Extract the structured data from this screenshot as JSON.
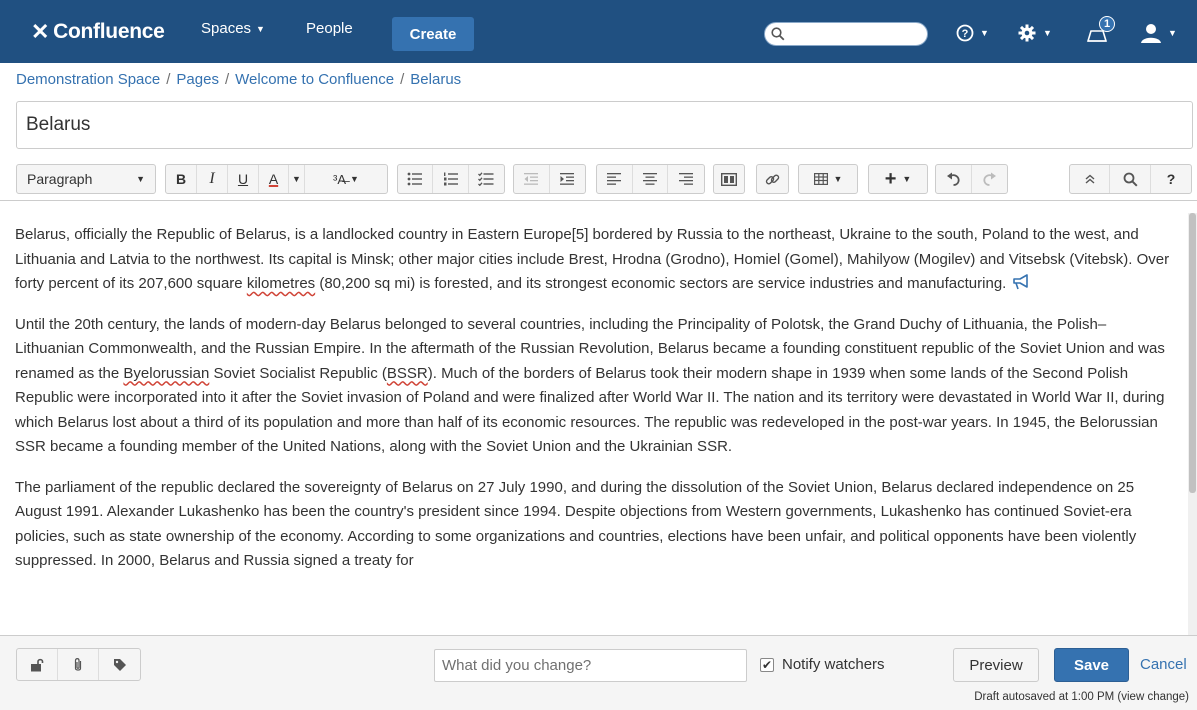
{
  "header": {
    "logo_text": "Confluence",
    "nav": {
      "spaces": "Spaces",
      "people": "People",
      "create": "Create"
    },
    "search_placeholder": "",
    "notification_count": "1",
    "brand_color": "#205081",
    "accent_color": "#3572b0"
  },
  "breadcrumb": [
    "Demonstration Space",
    "Pages",
    "Welcome to Confluence",
    "Belarus"
  ],
  "page_title": "Belarus",
  "toolbar": {
    "paragraph_style": "Paragraph",
    "bold": "B",
    "italic": "I",
    "underline": "U",
    "text_color": "A"
  },
  "content": {
    "p1": [
      "Belarus, officially the Republic of Belarus, is a landlocked country in Eastern Europe[5] bordered by Russia to the northeast, Ukraine to the south, Poland to the west, and Lithuania and Latvia to the northwest. Its capital is Minsk; other major cities include Brest, Hrodna (Grodno), Homiel (Gomel), Mahilyow (Mogilev) and Vitsebsk (Vitebsk). Over forty percent of its 207,600 square ",
      "kilometres",
      " (80,200 sq mi) is forested, and its strongest economic sectors are service industries and manufacturing."
    ],
    "p2": [
      "Until the 20th century, the lands of modern-day Belarus belonged to several countries, including the Principality of Polotsk, the Grand Duchy of Lithuania, the Polish–Lithuanian Commonwealth, and the Russian Empire. In the aftermath of the Russian Revolution, Belarus became a founding constituent republic of the Soviet Union and was renamed as the ",
      "Byelorussian",
      " Soviet Socialist Republic (",
      "BSSR",
      "). Much of the borders of Belarus took their modern shape in 1939 when some lands of the Second Polish Republic were incorporated into it after the Soviet invasion of Poland and were finalized after World War II. The nation and its territory were devastated in World War II, during which Belarus lost about a third of its population and more than half of its economic resources. The republic was redeveloped in the post-war years. In 1945, the Belorussian SSR became a founding member of the United Nations, along with the Soviet Union and the Ukrainian SSR."
    ],
    "p3": "The parliament of the republic declared the sovereignty of Belarus on 27 July 1990, and during the dissolution of the Soviet Union, Belarus declared independence on 25 August 1991. Alexander Lukashenko has been the country's president since 1994. Despite objections from Western governments, Lukashenko has continued Soviet-era policies, such as state ownership of the economy. According to some organizations and countries, elections have been unfair, and political opponents have been violently suppressed. In 2000, Belarus and Russia signed a treaty for"
  },
  "footer": {
    "change_placeholder": "What did you change?",
    "notify_label": "Notify watchers",
    "notify_checked": true,
    "preview_label": "Preview",
    "save_label": "Save",
    "cancel_label": "Cancel",
    "autosave_text": "Draft autosaved at 1:00 PM (view change)"
  }
}
